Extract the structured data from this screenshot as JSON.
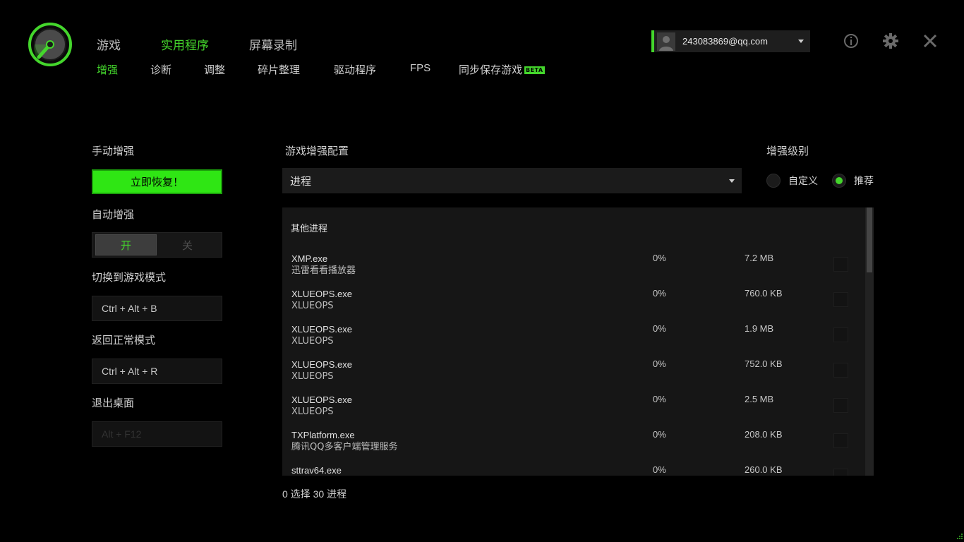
{
  "colors": {
    "accent": "#44d62c",
    "background": "#000000",
    "panel": "#161616"
  },
  "logo": {
    "icon": "razer-cortex-speedometer-icon"
  },
  "nav": {
    "main_tabs": [
      "游戏",
      "实用程序",
      "屏幕录制"
    ],
    "active_main_tab": "实用程序",
    "sub_tabs": [
      "增强",
      "诊断",
      "调整",
      "碎片整理",
      "驱动程序",
      "FPS",
      "同步保存游戏"
    ],
    "active_sub_tab": "增强",
    "beta_badge": "BETA"
  },
  "account": {
    "email": "243083869@qq.com",
    "avatar_icon": "user-avatar-icon"
  },
  "header_icons": [
    "info-icon",
    "gear-icon",
    "close-icon"
  ],
  "left": {
    "manual_boost_label": "手动增强",
    "restore_button": "立即恢复！",
    "auto_boost_label": "自动增强",
    "toggle_on": "开",
    "toggle_off": "关",
    "toggle_value": "开",
    "switch_game_mode_label": "切换到游戏模式",
    "switch_game_mode_hotkey": "Ctrl + Alt + B",
    "return_normal_label": "返回正常模式",
    "return_normal_hotkey": "Ctrl + Alt + R",
    "exit_desktop_label": "退出桌面",
    "exit_desktop_hotkey": "Alt + F12"
  },
  "config": {
    "label": "游戏增强配置",
    "selected": "进程"
  },
  "level": {
    "label": "增强级别",
    "options": [
      "自定义",
      "推荐"
    ],
    "selected": "推荐"
  },
  "process_panel": {
    "group_title": "其他进程",
    "rows": [
      {
        "name": "XMP.exe",
        "desc": "迅雷看看播放器",
        "cpu": "0%",
        "mem": "7.2 MB",
        "checked": false
      },
      {
        "name": "XLUEOPS.exe",
        "desc": "XLUEOPS",
        "cpu": "0%",
        "mem": "760.0 KB",
        "checked": false
      },
      {
        "name": "XLUEOPS.exe",
        "desc": "XLUEOPS",
        "cpu": "0%",
        "mem": "1.9 MB",
        "checked": false
      },
      {
        "name": "XLUEOPS.exe",
        "desc": "XLUEOPS",
        "cpu": "0%",
        "mem": "752.0 KB",
        "checked": false
      },
      {
        "name": "XLUEOPS.exe",
        "desc": "XLUEOPS",
        "cpu": "0%",
        "mem": "2.5 MB",
        "checked": false
      },
      {
        "name": "TXPlatform.exe",
        "desc": "腾讯QQ多客户端管理服务",
        "cpu": "0%",
        "mem": "208.0 KB",
        "checked": false
      },
      {
        "name": "sttrav64.exe",
        "desc": "",
        "cpu": "0%",
        "mem": "260.0 KB",
        "checked": false
      }
    ]
  },
  "footer": {
    "status": "0 选择 30 进程"
  }
}
